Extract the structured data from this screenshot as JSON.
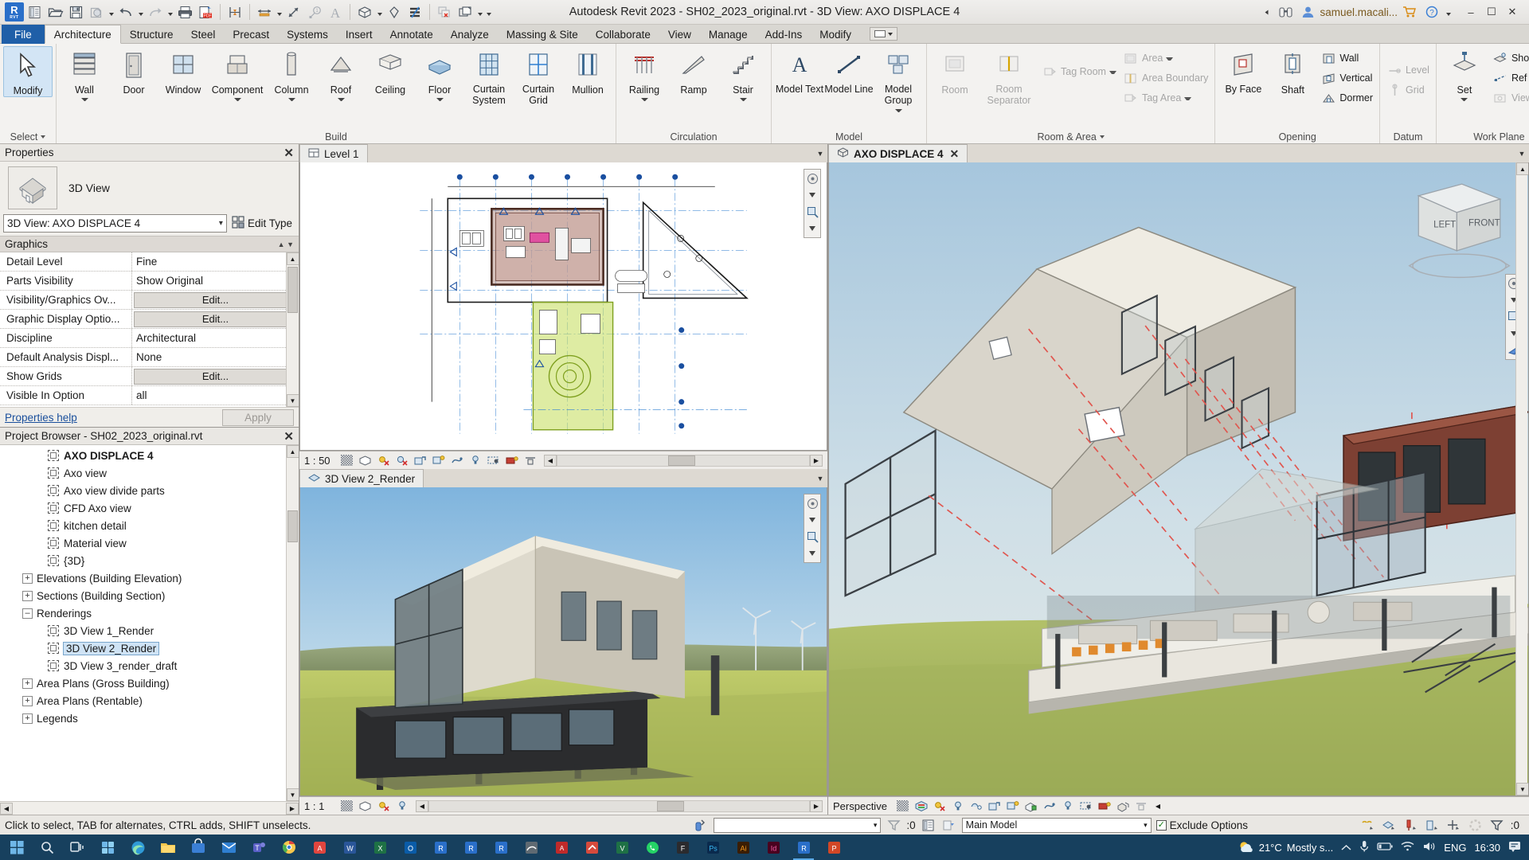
{
  "window": {
    "title": "Autodesk Revit 2023 - SH02_2023_original.rvt - 3D View: AXO DISPLACE 4",
    "user": "samuel.macali...",
    "minimize": "–",
    "maximize": "☐",
    "close": "✕"
  },
  "quick_access": {
    "icons": [
      "revit-logo",
      "new-project-icon",
      "open-icon",
      "save-icon",
      "save-as-icon",
      "undo-icon",
      "redo-icon",
      "print-icon",
      "export-pdf-icon",
      "measure-icon",
      "aligned-dimension-icon",
      "tag-icon",
      "text-icon",
      "default-3d-view-icon",
      "section-icon",
      "thin-lines-icon",
      "close-hidden-windows-icon",
      "switch-windows-icon",
      "customize-qat-icon"
    ]
  },
  "ribbon_tabs": [
    {
      "label": "File",
      "type": "file"
    },
    {
      "label": "Architecture",
      "type": "active"
    },
    {
      "label": "Structure",
      "type": "normal"
    },
    {
      "label": "Steel",
      "type": "normal"
    },
    {
      "label": "Precast",
      "type": "normal"
    },
    {
      "label": "Systems",
      "type": "normal"
    },
    {
      "label": "Insert",
      "type": "normal"
    },
    {
      "label": "Annotate",
      "type": "normal"
    },
    {
      "label": "Analyze",
      "type": "normal"
    },
    {
      "label": "Massing & Site",
      "type": "normal"
    },
    {
      "label": "Collaborate",
      "type": "normal"
    },
    {
      "label": "View",
      "type": "normal"
    },
    {
      "label": "Manage",
      "type": "normal"
    },
    {
      "label": "Add-Ins",
      "type": "normal"
    },
    {
      "label": "Modify",
      "type": "normal"
    }
  ],
  "ribbon": {
    "select_panel": {
      "button": "Modify",
      "label": "Select"
    },
    "panels": [
      {
        "label": "Build",
        "has_dropdown": false,
        "buttons": [
          {
            "label": "Wall",
            "icon": "wall-icon",
            "dropdown": true
          },
          {
            "label": "Door",
            "icon": "door-icon",
            "dropdown": false
          },
          {
            "label": "Window",
            "icon": "window-icon",
            "dropdown": false
          },
          {
            "label": "Component",
            "icon": "component-icon",
            "dropdown": true
          },
          {
            "label": "Column",
            "icon": "column-icon",
            "dropdown": true
          },
          {
            "label": "Roof",
            "icon": "roof-icon",
            "dropdown": true
          },
          {
            "label": "Ceiling",
            "icon": "ceiling-icon",
            "dropdown": false
          },
          {
            "label": "Floor",
            "icon": "floor-icon",
            "dropdown": true
          },
          {
            "label": "Curtain System",
            "icon": "curtain-system-icon",
            "dropdown": false
          },
          {
            "label": "Curtain Grid",
            "icon": "curtain-grid-icon",
            "dropdown": false
          },
          {
            "label": "Mullion",
            "icon": "mullion-icon",
            "dropdown": false
          }
        ]
      },
      {
        "label": "Circulation",
        "has_dropdown": false,
        "buttons": [
          {
            "label": "Railing",
            "icon": "railing-icon",
            "dropdown": true
          },
          {
            "label": "Ramp",
            "icon": "ramp-icon",
            "dropdown": false
          },
          {
            "label": "Stair",
            "icon": "stair-icon",
            "dropdown": true
          }
        ]
      },
      {
        "label": "Model",
        "has_dropdown": false,
        "buttons": [
          {
            "label": "Model Text",
            "icon": "model-text-icon",
            "dropdown": false
          },
          {
            "label": "Model Line",
            "icon": "model-line-icon",
            "dropdown": false
          },
          {
            "label": "Model Group",
            "icon": "model-group-icon",
            "dropdown": true
          }
        ]
      },
      {
        "label": "Room & Area",
        "has_dropdown": true,
        "buttons": [
          {
            "label": "Room",
            "icon": "room-icon",
            "dropdown": false,
            "disabled": true
          },
          {
            "label": "Room Separator",
            "icon": "room-separator-icon",
            "dropdown": false,
            "disabled": true
          }
        ],
        "small_buttons_a": [
          {
            "label": "Tag Room",
            "icon": "tag-room-icon",
            "dropdown": true,
            "disabled": true
          }
        ],
        "small_buttons_b": [
          {
            "label": "Area",
            "icon": "area-icon",
            "dropdown": true,
            "disabled": true
          },
          {
            "label": "Area Boundary",
            "icon": "area-boundary-icon",
            "dropdown": false,
            "disabled": true
          },
          {
            "label": "Tag Area",
            "icon": "tag-area-icon",
            "dropdown": true,
            "disabled": true
          }
        ]
      },
      {
        "label": "Opening",
        "has_dropdown": false,
        "buttons": [
          {
            "label": "By Face",
            "icon": "opening-by-face-icon",
            "dropdown": false
          },
          {
            "label": "Shaft",
            "icon": "shaft-opening-icon",
            "dropdown": false
          }
        ],
        "small_buttons_a": [
          {
            "label": "Wall",
            "icon": "wall-opening-icon",
            "dropdown": false
          },
          {
            "label": "Vertical",
            "icon": "vertical-opening-icon",
            "dropdown": false
          },
          {
            "label": "Dormer",
            "icon": "dormer-opening-icon",
            "dropdown": false
          }
        ]
      },
      {
        "label": "Datum",
        "has_dropdown": false,
        "small_buttons_a": [
          {
            "label": "Level",
            "icon": "level-icon",
            "dropdown": false,
            "disabled": true
          },
          {
            "label": "Grid",
            "icon": "grid-icon",
            "dropdown": false,
            "disabled": true
          }
        ]
      },
      {
        "label": "Work Plane",
        "has_dropdown": false,
        "buttons": [
          {
            "label": "Set",
            "icon": "set-work-plane-icon",
            "dropdown": true
          }
        ],
        "small_buttons_a": [
          {
            "label": "Show",
            "icon": "show-work-plane-icon",
            "dropdown": false
          },
          {
            "label": "Ref Plane",
            "icon": "ref-plane-icon",
            "dropdown": false
          },
          {
            "label": "Viewer",
            "icon": "work-plane-viewer-icon",
            "dropdown": false
          }
        ]
      }
    ]
  },
  "properties": {
    "panel_title": "Properties",
    "close": "✕",
    "family_type": "3D View",
    "type_selector": "3D View: AXO DISPLACE 4",
    "edit_type_label": "Edit Type",
    "group_header": "Graphics",
    "rows": [
      {
        "name": "Detail Level",
        "value": "Fine",
        "is_button": false
      },
      {
        "name": "Parts Visibility",
        "value": "Show Original",
        "is_button": false
      },
      {
        "name": "Visibility/Graphics Ov...",
        "value": "Edit...",
        "is_button": true
      },
      {
        "name": "Graphic Display Optio...",
        "value": "Edit...",
        "is_button": true
      },
      {
        "name": "Discipline",
        "value": "Architectural",
        "is_button": false
      },
      {
        "name": "Default Analysis Displ...",
        "value": "None",
        "is_button": false
      },
      {
        "name": "Show Grids",
        "value": "Edit...",
        "is_button": true
      },
      {
        "name": "Visible In Option",
        "value": "all",
        "is_button": false
      }
    ],
    "help_link": "Properties help",
    "apply_button": "Apply"
  },
  "project_browser": {
    "panel_title": "Project Browser - SH02_2023_original.rvt",
    "close": "✕",
    "nodes": [
      {
        "label": "AXO DISPLACE 4",
        "indent": 3,
        "kind": "view",
        "bold": true,
        "selected": true
      },
      {
        "label": "Axo view",
        "indent": 3,
        "kind": "view",
        "bold": false,
        "selected": false
      },
      {
        "label": "Axo view divide parts",
        "indent": 3,
        "kind": "view",
        "bold": false,
        "selected": false
      },
      {
        "label": "CFD Axo view",
        "indent": 3,
        "kind": "view",
        "bold": false,
        "selected": false
      },
      {
        "label": "kitchen detail",
        "indent": 3,
        "kind": "view",
        "bold": false,
        "selected": false
      },
      {
        "label": "Material view",
        "indent": 3,
        "kind": "view",
        "bold": false,
        "selected": false
      },
      {
        "label": "{3D}",
        "indent": 3,
        "kind": "view",
        "bold": false,
        "selected": false
      },
      {
        "label": "Elevations (Building Elevation)",
        "indent": 1,
        "kind": "group",
        "expander": "+",
        "bold": false,
        "selected": false
      },
      {
        "label": "Sections (Building Section)",
        "indent": 1,
        "kind": "group",
        "expander": "+",
        "bold": false,
        "selected": false
      },
      {
        "label": "Renderings",
        "indent": 1,
        "kind": "group",
        "expander": "–",
        "bold": false,
        "selected": false
      },
      {
        "label": "3D View 1_Render",
        "indent": 3,
        "kind": "view",
        "bold": false,
        "selected": false
      },
      {
        "label": "3D View 2_Render",
        "indent": 3,
        "kind": "view",
        "bold": false,
        "selected": true
      },
      {
        "label": "3D View 3_render_draft",
        "indent": 3,
        "kind": "view",
        "bold": false,
        "selected": false
      },
      {
        "label": "Area Plans (Gross Building)",
        "indent": 1,
        "kind": "group",
        "expander": "+",
        "bold": false,
        "selected": false
      },
      {
        "label": "Area Plans (Rentable)",
        "indent": 1,
        "kind": "group",
        "expander": "+",
        "bold": false,
        "selected": false
      },
      {
        "label": "Legends",
        "indent": 1,
        "kind": "group",
        "expander": "+",
        "bold": false,
        "selected": false
      }
    ]
  },
  "view_tabs": {
    "plan": {
      "label": "Level 1",
      "icon": "plan-view-icon"
    },
    "render": {
      "label": "3D View 2_Render",
      "icon": "render-view-icon"
    },
    "axo": {
      "label": "AXO DISPLACE 4",
      "icon": "3d-view-icon",
      "close": "✕"
    }
  },
  "view_control_bars": {
    "plan": {
      "scale": "1 : 50"
    },
    "render": {
      "scale": "1 : 1"
    },
    "axo": {
      "scale": "Perspective"
    }
  },
  "status_bar": {
    "hint": "Click to select, TAB for alternates, CTRL adds, SHIFT unselects.",
    "filter_value": "",
    "selection_count": ":0",
    "worksets_value": "Main Model",
    "exclude_options_label": "Exclude Options",
    "exclude_options_checked": true,
    "filter_count": ":0"
  },
  "taskbar": {
    "items": [
      "start-icon",
      "search-icon",
      "task-view-icon",
      "widgets-icon",
      "edge-icon",
      "explorer-icon",
      "store-icon",
      "mail-icon",
      "teams-icon",
      "chrome-icon",
      "acrobat-icon",
      "word-icon",
      "excel-icon",
      "outlook-icon",
      "revit-a-icon",
      "revit-b-icon",
      "revit-c-icon",
      "rhino-icon",
      "autocad-icon",
      "sketchup-icon",
      "vray-icon",
      "whatsapp-icon",
      "figma-icon",
      "photoshop-icon",
      "illustrator-icon",
      "indesign-icon",
      "revit-active-icon",
      "powerpoint-icon"
    ],
    "tray": {
      "temperature": "21°C",
      "weather": "Mostly s...",
      "language": "ENG",
      "time": "16:30",
      "icons": [
        "show-hidden-icons",
        "microphone-icon",
        "battery-icon",
        "wifi-icon",
        "volume-icon",
        "notifications-icon"
      ]
    }
  }
}
